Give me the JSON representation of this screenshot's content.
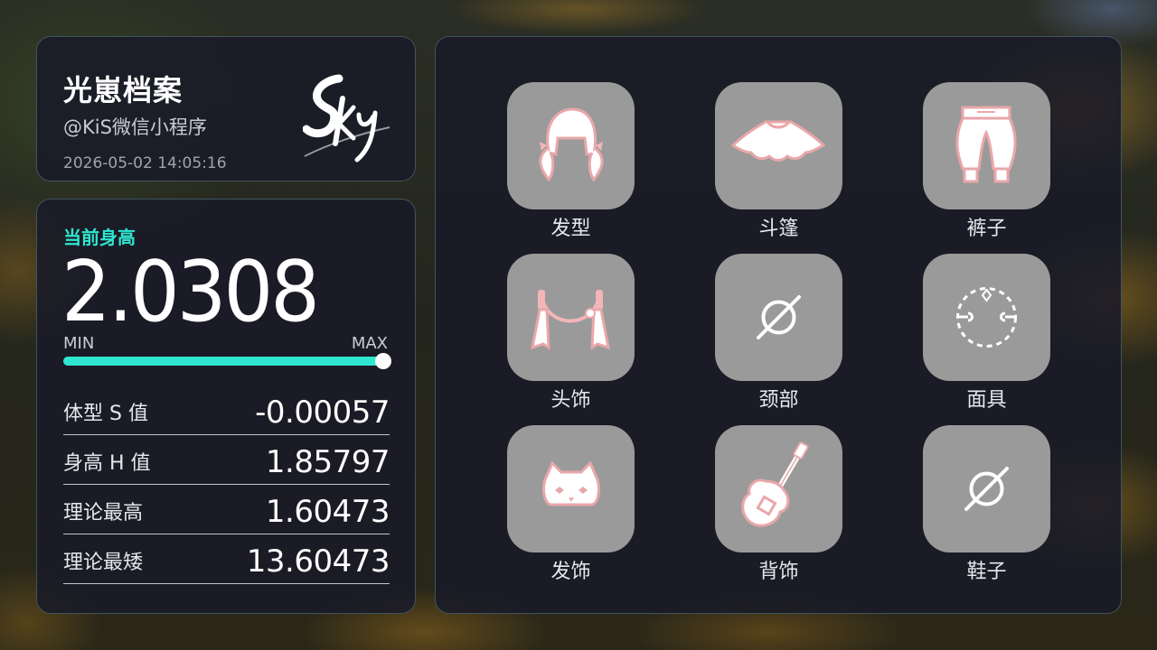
{
  "profile": {
    "title": "光崽档案",
    "subtitle": "@KiS微信小程序",
    "timestamp": "2026-05-02 14:05:16",
    "logo_text": "Sky",
    "logo_icon": "sky-logo-icon"
  },
  "height": {
    "label": "当前身高",
    "value": "2.0308",
    "min_label": "MIN",
    "max_label": "MAX",
    "bar_fraction": 1.0,
    "accent_color": "#2fe6cf"
  },
  "stats": [
    {
      "label": "体型 S 值",
      "value": "-0.00057"
    },
    {
      "label": "身高 H 值",
      "value": "1.85797"
    },
    {
      "label": "理论最高",
      "value": "1.60473"
    },
    {
      "label": "理论最矮",
      "value": "13.60473"
    }
  ],
  "items": [
    {
      "label": "发型",
      "icon": "hairstyle-icon"
    },
    {
      "label": "斗篷",
      "icon": "cape-icon"
    },
    {
      "label": "裤子",
      "icon": "pants-icon"
    },
    {
      "label": "头饰",
      "icon": "headwear-icon"
    },
    {
      "label": "颈部",
      "icon": "empty-slot-icon"
    },
    {
      "label": "面具",
      "icon": "mask-placeholder-icon"
    },
    {
      "label": "发饰",
      "icon": "cat-hair-accessory-icon"
    },
    {
      "label": "背饰",
      "icon": "guitar-icon"
    },
    {
      "label": "鞋子",
      "icon": "empty-slot-icon"
    }
  ]
}
